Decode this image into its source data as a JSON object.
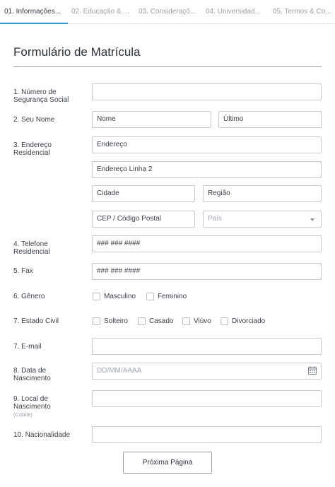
{
  "tabs": [
    {
      "label": "01. Informações..."
    },
    {
      "label": "02. Educação & ..."
    },
    {
      "label": "03. Consideraçõ..."
    },
    {
      "label": "04. Universidad..."
    },
    {
      "label": "05. Termos & Co..."
    }
  ],
  "form": {
    "title": "Formulário de Matrícula",
    "ssn": {
      "label": "1. Número de Segurança Social",
      "value": ""
    },
    "name": {
      "label": "2. Seu Nome",
      "first_placeholder": "Nome",
      "last_placeholder": "Último"
    },
    "address": {
      "label": "3. Endereço Residencial",
      "line1_placeholder": "Endereço",
      "line2_placeholder": "Endereço Linha 2",
      "city_placeholder": "Cidade",
      "region_placeholder": "Região",
      "zip_placeholder": "CEP / Código Postal",
      "country_placeholder": "País"
    },
    "phone": {
      "label": "4. Telefone Residencial",
      "placeholder": "### ### ####"
    },
    "fax": {
      "label": "5. Fax",
      "placeholder": "### ### ####"
    },
    "gender": {
      "label": "6. Gênero",
      "options": [
        "Masculino",
        "Feminino"
      ]
    },
    "marital": {
      "label": "7. Estado Civil",
      "options": [
        "Solteiro",
        "Casado",
        "Viúvo",
        "Divorciado"
      ]
    },
    "email": {
      "label": "7. E-mail",
      "value": ""
    },
    "birthdate": {
      "label": "8. Data de Nascimento",
      "placeholder": "DD/MM/AAAA"
    },
    "birthplace": {
      "label": "9. Local de Nascimento",
      "sublabel": "(Cidade)",
      "value": ""
    },
    "nationality": {
      "label": "10. Nacionalidade",
      "value": ""
    },
    "next_label": "Próxima Página"
  },
  "colors": {
    "accent": "#2f9bd0",
    "border": "#c5cad1",
    "text": "#3a3f47",
    "muted": "#9aa0a8"
  },
  "icons": {
    "calendar": "calendar-icon",
    "select": "chevron-down-icon"
  }
}
